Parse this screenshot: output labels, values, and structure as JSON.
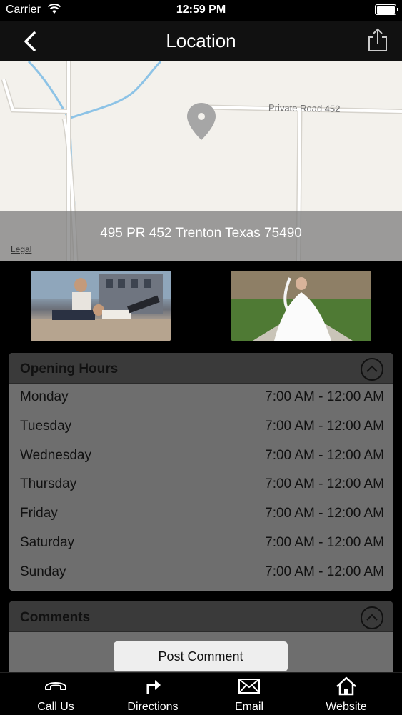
{
  "status_bar": {
    "carrier": "Carrier",
    "time": "12:59 PM"
  },
  "nav": {
    "title": "Location"
  },
  "map": {
    "road_label": "Private Road 452",
    "address": "495 PR 452 Trenton Texas 75490",
    "legal_label": "Legal"
  },
  "opening_hours": {
    "title": "Opening Hours",
    "rows": [
      {
        "day": "Monday",
        "time": "7:00 AM - 12:00 AM"
      },
      {
        "day": "Tuesday",
        "time": "7:00 AM - 12:00 AM"
      },
      {
        "day": "Wednesday",
        "time": "7:00 AM - 12:00 AM"
      },
      {
        "day": "Thursday",
        "time": "7:00 AM - 12:00 AM"
      },
      {
        "day": "Friday",
        "time": "7:00 AM - 12:00 AM"
      },
      {
        "day": "Saturday",
        "time": "7:00 AM - 12:00 AM"
      },
      {
        "day": "Sunday",
        "time": "7:00 AM - 12:00 AM"
      }
    ]
  },
  "comments": {
    "title": "Comments",
    "post_button": "Post Comment"
  },
  "tab_bar": {
    "items": [
      {
        "label": "Call Us",
        "icon": "phone-icon"
      },
      {
        "label": "Directions",
        "icon": "directions-arrow-icon"
      },
      {
        "label": "Email",
        "icon": "envelope-icon"
      },
      {
        "label": "Website",
        "icon": "home-icon"
      }
    ]
  }
}
